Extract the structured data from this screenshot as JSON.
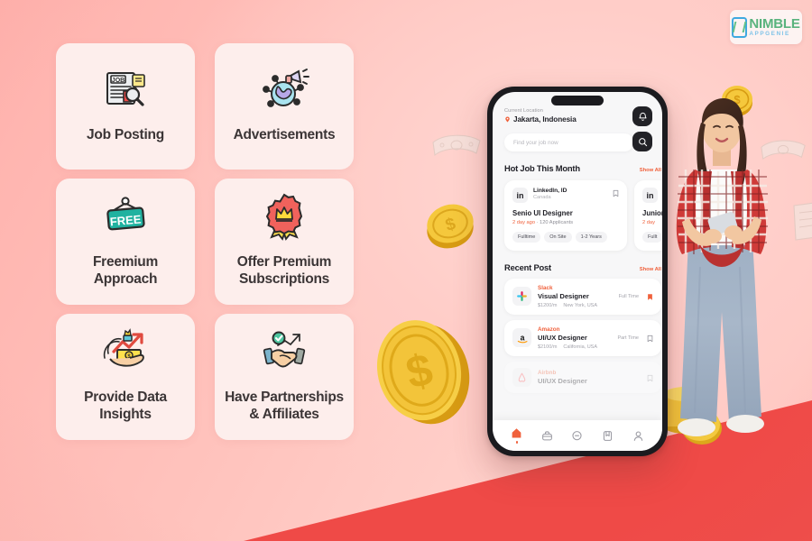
{
  "brand": {
    "name": "NIMBLE",
    "sub": "APPGENIE",
    "phone_icon": "phone-logo-icon"
  },
  "features": [
    {
      "id": "job-posting",
      "label": "Job Posting",
      "icon": "newspaper-search-icon"
    },
    {
      "id": "advertisements",
      "label": "Advertisements",
      "icon": "globe-megaphone-icon"
    },
    {
      "id": "freemium",
      "label": "Freemium\nApproach",
      "line1": "Freemium",
      "line2": "Approach",
      "icon": "free-sign-icon"
    },
    {
      "id": "premium",
      "label": "Offer Premium\nSubscriptions",
      "line1": "Offer Premium",
      "line2": "Subscriptions",
      "icon": "premium-rosette-icon"
    },
    {
      "id": "data-insights",
      "label": "Provide Data\nInsights",
      "line1": "Provide Data",
      "line2": "Insights",
      "icon": "hand-money-growth-icon"
    },
    {
      "id": "partnerships",
      "label": "Have Partnerships\n& Affiliates",
      "line1": "Have Partnerships",
      "line2": "& Affiliates",
      "icon": "handshake-check-icon"
    }
  ],
  "phone": {
    "location": {
      "label": "Current Location",
      "city": "Jakarta, Indonesia",
      "pin_icon": "location-pin-icon"
    },
    "actions": {
      "bell": "notification-bell-icon",
      "search": "search-icon"
    },
    "search": {
      "placeholder": "Find your job now"
    },
    "hot": {
      "title": "Hot Job This Month",
      "show_all": "Show All",
      "cards": [
        {
          "company": "LinkedIn, ID",
          "country": "Canada",
          "logo": "in",
          "role": "Senio UI Designer",
          "ago": "2 day ago",
          "applicants": "· 120 Applicants",
          "tags": [
            "Fulltime",
            "On Site",
            "1-2 Years"
          ],
          "bookmark": "bookmark-outline-icon"
        },
        {
          "company": "LinkedIn",
          "logo": "in",
          "role": "Junior",
          "ago": "2 day",
          "tags": [
            "Fullt"
          ]
        }
      ]
    },
    "recent": {
      "title": "Recent Post",
      "show_all": "Show All",
      "items": [
        {
          "company": "Slack",
          "logo": "slack-logo-icon",
          "role": "Visual Designer",
          "salary": "$1200/m",
          "location": "New York, USA",
          "type": "Full Time",
          "bookmark": "bookmark-filled-icon"
        },
        {
          "company": "Amazon",
          "logo": "amazon-logo-icon",
          "role": "UI/UX Designer",
          "salary": "$2100/m",
          "location": "California, USA",
          "type": "Part Time",
          "bookmark": "bookmark-outline-icon"
        },
        {
          "company": "Airbnb",
          "logo": "airbnb-logo-icon",
          "role": "UI/UX Designer",
          "salary": "",
          "location": "",
          "type": "",
          "bookmark": "bookmark-outline-icon"
        }
      ]
    },
    "tabs": [
      {
        "id": "home",
        "icon": "home-icon",
        "active": true
      },
      {
        "id": "jobs",
        "icon": "briefcase-icon",
        "active": false
      },
      {
        "id": "messages",
        "icon": "chat-icon",
        "active": false
      },
      {
        "id": "saved",
        "icon": "bookmark-icon",
        "active": false
      },
      {
        "id": "profile",
        "icon": "person-icon",
        "active": false
      }
    ]
  },
  "decor": {
    "coin_big": "gold-coin-dollar-icon",
    "coins": [
      "gold-coin-icon",
      "gold-coin-icon",
      "gold-coin-icon"
    ],
    "bills": [
      "banknote-icon",
      "banknote-icon",
      "banknote-icon"
    ],
    "woman": "woman-with-phone-photo"
  },
  "colors": {
    "background": "#ffb9b4",
    "wedge": "#ef4a47",
    "card": "#fdeeec",
    "accent": "#f0613c",
    "gold": "#f2c33c",
    "text": "#3b3536"
  }
}
